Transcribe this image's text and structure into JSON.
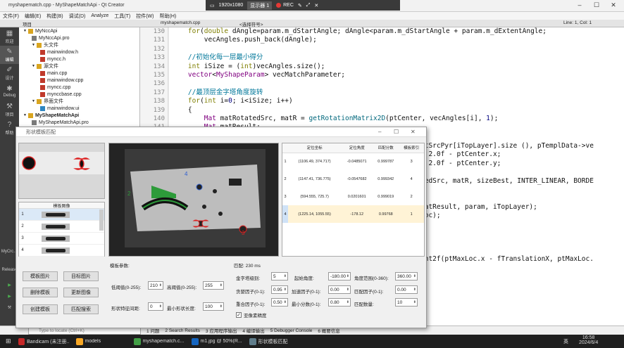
{
  "window": {
    "title": "myshapematch.cpp - MyShapeMatchApi - Qt Creator"
  },
  "recorder": {
    "resolution": "1920x1080",
    "display": "显示器 1",
    "rec": "REC"
  },
  "menu": [
    "文件(F)",
    "编辑(E)",
    "构建(B)",
    "调试(D)",
    "Analyze",
    "工具(T)",
    "控件(W)",
    "帮助(H)"
  ],
  "toolrow": {
    "project_label": "项目",
    "open_file": "myshapematch.cpp",
    "symbol": "<选择符号>",
    "position": "Line: 1, Col: 1"
  },
  "modes": [
    {
      "icon": "▦",
      "label": "欢迎"
    },
    {
      "icon": "✎",
      "label": "编辑"
    },
    {
      "icon": "✐",
      "label": "设计"
    },
    {
      "icon": "✱",
      "label": "Debug"
    },
    {
      "icon": "⚒",
      "label": "项目"
    },
    {
      "icon": "?",
      "label": "帮助"
    }
  ],
  "modes_bottom": [
    "MyCrc…",
    "Release"
  ],
  "tree": [
    {
      "indent": 0,
      "text": "MyNccApi",
      "icon": "folder"
    },
    {
      "indent": 1,
      "text": "MyNccApi.pro",
      "icon": "pro"
    },
    {
      "indent": 1,
      "text": "头文件",
      "icon": "folder"
    },
    {
      "indent": 2,
      "text": "mainwindow.h",
      "icon": "h"
    },
    {
      "indent": 2,
      "text": "myncc.h",
      "icon": "h"
    },
    {
      "indent": 1,
      "text": "源文件",
      "icon": "folder"
    },
    {
      "indent": 2,
      "text": "main.cpp",
      "icon": "cpp"
    },
    {
      "indent": 2,
      "text": "mainwindow.cpp",
      "icon": "cpp"
    },
    {
      "indent": 2,
      "text": "myncc.cpp",
      "icon": "cpp"
    },
    {
      "indent": 2,
      "text": "mynccbase.cpp",
      "icon": "cpp"
    },
    {
      "indent": 1,
      "text": "界面文件",
      "icon": "folder"
    },
    {
      "indent": 2,
      "text": "mainwindow.ui",
      "icon": "ui"
    },
    {
      "indent": 0,
      "text": "MyShapeMatchApi",
      "icon": "folder",
      "bold": true
    },
    {
      "indent": 1,
      "text": "MyShapeMatchApi.pro",
      "icon": "pro"
    }
  ],
  "gutter": [
    "130",
    "131",
    "132",
    "133",
    "134",
    "135",
    "136",
    "137",
    "138",
    "139",
    "140",
    "141"
  ],
  "code": [
    "    for(double dAngle=param.m_dStartAngle; dAngle<param.m_dStartAngle + param.m_dExtentAngle;",
    "        vecAngles.push_back(dAngle);",
    "",
    "    //初始化每一层最小得分",
    "    int iSize = (int)vecAngles.size();",
    "    vector<MyShapeParam> vecMatchParameter;",
    "",
    "    //最顶层金字塔角度旋转",
    "    for(int i=0; i<iSize; i++)",
    "    {",
    "        Mat matRotatedSrc, matR = getRotationMatrix2D(ptCenter, vecAngles[i], 1);",
    "        Mat matResult;"
  ],
  "code_right": [
    "atSrcPyr[iTopLayer].size (), pTemplData->ve",
    "/ 2.0f - ptCenter.x;",
    "/ 2.0f - ptCenter.y;",
    "",
    "tedSrc, matR, sizeBest, INTER_LINEAR, BORDE",
    "",
    "",
    "matResult, param, iTopLayer);",
    "Loc);",
    "",
    "",
    "",
    "",
    "int2f(ptMaxLoc.x - fTranslationX, ptMaxLoc."
  ],
  "dialog": {
    "title": "形状模板匹配",
    "template_list_header": "模板图像",
    "template_rows": [
      "1",
      "2",
      "3",
      "4"
    ],
    "buttons": {
      "template_image": "模板图片",
      "target_image": "目标图片",
      "delete_template": "删除模板",
      "update_image": "更新图像",
      "create_template": "创建模板",
      "match_search": "匹配搜索"
    },
    "template_params": {
      "title": "模板参数:",
      "low_thresh_label": "低阈值(0-255):",
      "low_thresh": "210",
      "high_thresh_label": "高阈值(0-255):",
      "high_thresh": "255",
      "feature_spacing_label": "形状特征间距:",
      "feature_spacing": "0",
      "min_length_label": "最小形状长度:",
      "min_length": "100"
    },
    "match_params": {
      "title": "匹配: 230 ms",
      "pyramid_label": "金字塔级别:",
      "pyramid": "5",
      "start_angle_label": "起始角度:",
      "start_angle": "-180.00",
      "angle_range_label": "角度范围(0-360):",
      "angle_range": "360.00",
      "greed_label": "贪婪因子(0-1):",
      "greed": "0.95",
      "speed_label": "加速因子(0-1):",
      "speed": "0.00",
      "match_coef_label": "匹配因子(0-1):",
      "match_coef": "0.00",
      "overlap_label": "重合因子(0-1):",
      "overlap": "0.50",
      "min_score_label": "最小分数(0-1):",
      "min_score": "0.80",
      "match_count_label": "匹配数量:",
      "match_count": "10",
      "subpixel_label": "亚像素精度"
    },
    "results": {
      "headers": [
        "",
        "定位坐标",
        "定位角度",
        "匹配分数",
        "模板索引"
      ],
      "rows": [
        [
          "1",
          "(1106.49, 374.717)",
          "-0.0485071",
          "0.999787",
          "3"
        ],
        [
          "2",
          "(1147.41, 736.775)",
          "-0.0547682",
          "0.999342",
          "4"
        ],
        [
          "3",
          "(594.555, 725.7)",
          "0.0201601",
          "0.999019",
          "2"
        ],
        [
          "4",
          "(1225.14, 1055.55)",
          "-178.12",
          "0.99768",
          "1"
        ]
      ]
    },
    "labels_on_image": [
      "4",
      "2",
      "3"
    ]
  },
  "output_tabs": [
    "1 问题",
    "2 Search Results",
    "3 应用程序输出",
    "4 编译输出",
    "5 Debugger Console",
    "6 概要信息"
  ],
  "locator_placeholder": "Type to locate (Ctrl+K)",
  "taskbar": {
    "apps": [
      "Bandicam (未注册...",
      "models",
      "myshapematch.c...",
      "m1.jpg @ 50%(R...",
      "形状模板匹配"
    ],
    "time": "16:58",
    "date": "2024/6/4",
    "lang": "英"
  }
}
